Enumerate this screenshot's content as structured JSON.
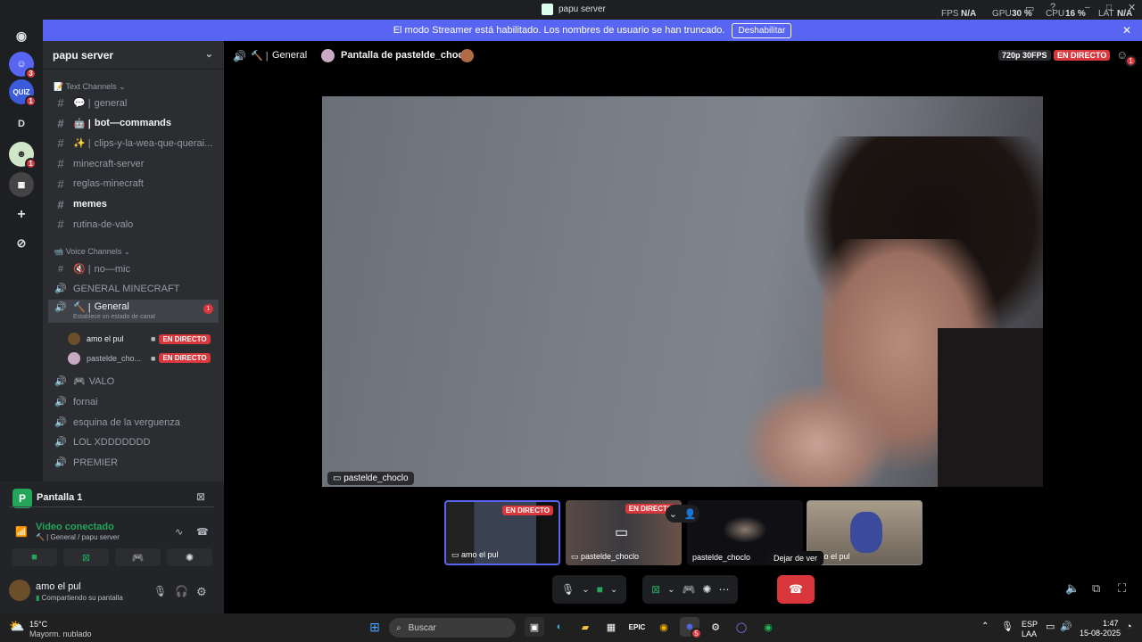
{
  "titlebar": {
    "title": "papu server",
    "fps_label": "FPS",
    "fps_value": "N/A",
    "gpu_label": "GPU",
    "gpu_value": "30 %",
    "cpu_label": "CPU",
    "cpu_value": "16 %",
    "lat_label": "LAT",
    "lat_value": "N/A"
  },
  "servers": [
    {
      "icon": "discord-home-icon",
      "badge": ""
    },
    {
      "icon": "discord-avatar-icon",
      "badge": "3"
    },
    {
      "icon": "quiz-server-icon",
      "label": "QUIZ",
      "badge": "1"
    },
    {
      "icon": "letter-server-icon",
      "label": "D",
      "badge": ""
    },
    {
      "icon": "papu-server-icon",
      "badge": "1"
    },
    {
      "icon": "group-server-icon",
      "badge": ""
    },
    {
      "icon": "add-server-icon",
      "badge": ""
    },
    {
      "icon": "discover-icon",
      "badge": ""
    }
  ],
  "banner": {
    "text": "El modo Streamer está habilitado. Los nombres de usuario se han truncado.",
    "button": "Deshabilitar"
  },
  "sidebar": {
    "server_name": "papu server",
    "text_category": "Text Channels",
    "voice_category": "Voice Channels",
    "text_channels": [
      {
        "label": "general",
        "prefix": "💬 |",
        "unread": false
      },
      {
        "label": "bot—commands",
        "prefix": "🤖 |",
        "unread": true
      },
      {
        "label": "clips-y-la-wea-que-querai...",
        "prefix": "✨ |",
        "unread": false
      },
      {
        "label": "minecraft-server",
        "prefix": "",
        "unread": false
      },
      {
        "label": "reglas-minecraft",
        "prefix": "",
        "unread": false
      },
      {
        "label": "memes",
        "prefix": "",
        "unread": true
      },
      {
        "label": "rutina-de-valo",
        "prefix": "",
        "unread": false
      }
    ],
    "voice_channels": [
      {
        "label": "no—mic",
        "prefix": "🔇 |",
        "type": "text"
      },
      {
        "label": "GENERAL MINECRAFT",
        "prefix": "",
        "type": "voice"
      },
      {
        "label": "General",
        "prefix": "🔨 |",
        "type": "voice",
        "status": "Establece un estado de canal",
        "badge": "1"
      },
      {
        "label": "VALO",
        "prefix": "🎮",
        "type": "voice"
      },
      {
        "label": "fornai",
        "prefix": "",
        "type": "voice"
      },
      {
        "label": "esquina de la verguenza",
        "prefix": "",
        "type": "voice"
      },
      {
        "label": "LOL XDDDDDDD",
        "prefix": "",
        "type": "voice"
      },
      {
        "label": "PREMIER",
        "prefix": "",
        "type": "voice"
      }
    ],
    "voice_users": [
      {
        "name": "amo el pul",
        "live": "EN DIRECTO"
      },
      {
        "name": "pastelde_cho...",
        "live": "EN DIRECTO"
      }
    ]
  },
  "user_panel": {
    "screen_title": "Pantalla 1",
    "voice_status": "Video conectado",
    "voice_location": "General / papu server",
    "user_name": "amo el pul",
    "user_status": "Compartiendo su pantalla"
  },
  "header": {
    "channel": "General",
    "stream_title": "Pantalla de pastelde_choclo",
    "quality": "720p 30FPS",
    "live": "EN DIRECTO",
    "notif_badge": "1"
  },
  "stream": {
    "streamer_label": "pastelde_choclo"
  },
  "thumbnails": [
    {
      "name": "amo el pul",
      "live": "EN DIRECTO"
    },
    {
      "name": "pastelde_choclo",
      "live": "EN DIRECTO"
    },
    {
      "name": "pastelde_choclo",
      "live": ""
    },
    {
      "name": "amo el pul",
      "live": ""
    }
  ],
  "controls": {
    "tooltip": "Dejar de ver"
  },
  "taskbar": {
    "weather_temp": "15°C",
    "weather_desc": "Mayorm. nublado",
    "search_placeholder": "Buscar",
    "lang_top": "ESP",
    "lang_bottom": "LAA",
    "time": "1:47",
    "date": "15-08-2025",
    "discord_badge": "5"
  },
  "colors": {
    "blurple": "#5865f2",
    "live_red": "#da373c",
    "green": "#23a55a",
    "sidebar": "#2b2d31"
  }
}
